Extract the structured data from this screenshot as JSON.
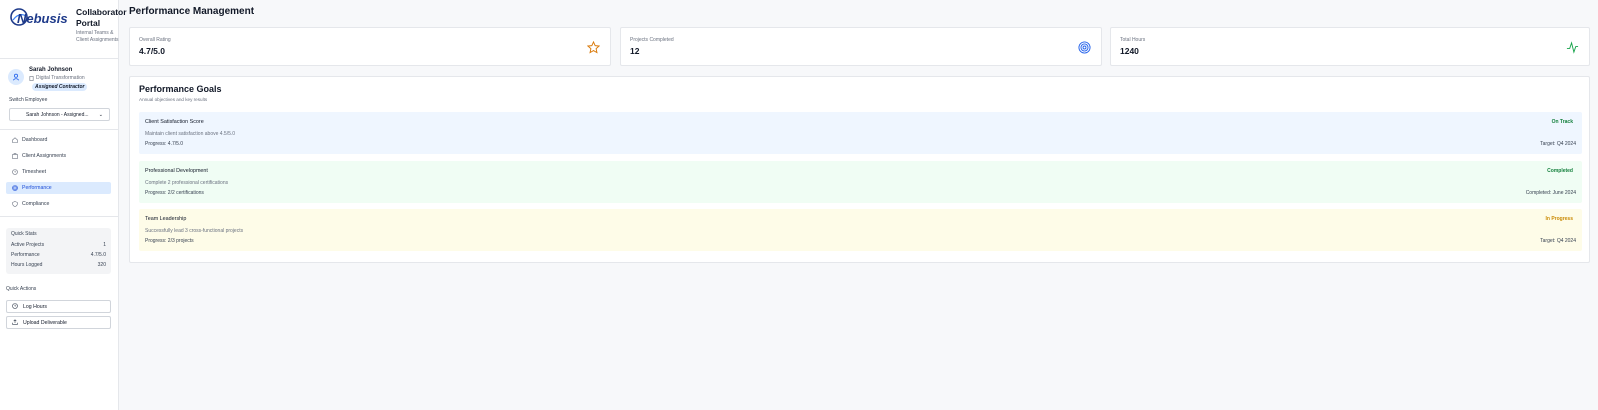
{
  "app": {
    "logo_text": "Nebusis",
    "title": "Collaborator Portal",
    "subtitle": "Internal Teams & Client Assignments"
  },
  "user": {
    "name": "Sarah Johnson",
    "department": "Digital Transformation",
    "badge": "Assigned Contractor"
  },
  "switch_employee": {
    "label": "Switch Employee",
    "selected": "Sarah Johnson - Assigned..."
  },
  "nav": {
    "items": [
      {
        "label": "Dashboard",
        "icon": "home-icon"
      },
      {
        "label": "Client Assignments",
        "icon": "briefcase-icon"
      },
      {
        "label": "Timesheet",
        "icon": "clock-icon"
      },
      {
        "label": "Performance",
        "icon": "target-icon",
        "active": true
      },
      {
        "label": "Compliance",
        "icon": "shield-icon"
      }
    ]
  },
  "quick_stats": {
    "title": "Quick Stats",
    "rows": [
      {
        "label": "Active Projects",
        "value": "1"
      },
      {
        "label": "Performance",
        "value": "4.7/5.0"
      },
      {
        "label": "Hours Logged",
        "value": "320"
      }
    ]
  },
  "quick_actions": {
    "title": "Quick Actions",
    "log_hours": "Log Hours",
    "upload": "Upload Deliverable"
  },
  "main": {
    "title": "Performance Management",
    "metrics": [
      {
        "label": "Overall Rating",
        "value": "4.7/5.0",
        "icon": "star-icon",
        "color": "#d97706"
      },
      {
        "label": "Projects Completed",
        "value": "12",
        "icon": "target-icon",
        "color": "#2563eb"
      },
      {
        "label": "Total Hours",
        "value": "1240",
        "icon": "activity-icon",
        "color": "#16a34a"
      }
    ],
    "goals_title": "Performance Goals",
    "goals_subtitle": "Annual objectives and key results",
    "goals": [
      {
        "name": "Client Satisfaction Score",
        "status": "On Track",
        "desc": "Maintain client satisfaction above 4.5/5.0",
        "progress": "Progress: 4.7/5.0",
        "target": "Target: Q4 2024",
        "bg": "#eff6ff",
        "status_color": "#15803d"
      },
      {
        "name": "Professional Development",
        "status": "Completed",
        "desc": "Complete 2 professional certifications",
        "progress": "Progress: 2/2 certifications",
        "target": "Completed: June 2024",
        "bg": "#f0fdf4",
        "status_color": "#15803d"
      },
      {
        "name": "Team Leadership",
        "status": "In Progress",
        "desc": "Successfully lead 3 cross-functional projects",
        "progress": "Progress: 2/3 projects",
        "target": "Target: Q4 2024",
        "bg": "#fefce8",
        "status_color": "#ca8a04"
      }
    ]
  }
}
